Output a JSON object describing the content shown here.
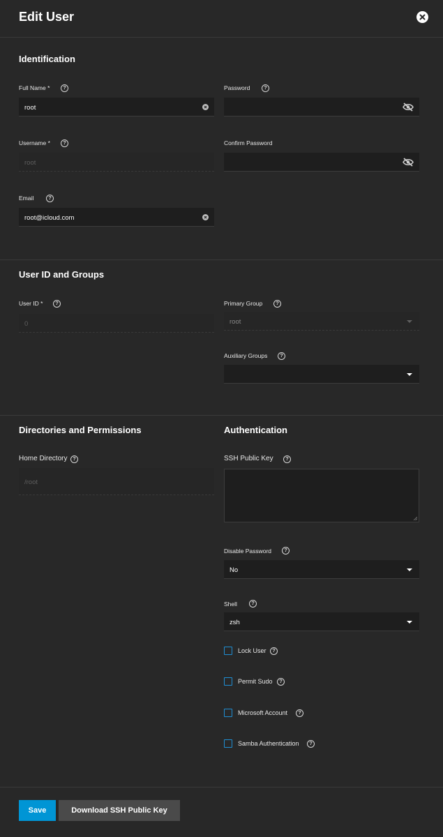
{
  "dialog": {
    "title": "Edit User"
  },
  "identification": {
    "title": "Identification",
    "full_name": {
      "label": "Full Name *",
      "value": "root"
    },
    "password": {
      "label": "Password",
      "value": ""
    },
    "username": {
      "label": "Username *",
      "value": "root"
    },
    "confirm_password": {
      "label": "Confirm Password",
      "value": ""
    },
    "email": {
      "label": "Email",
      "value": "root@icloud.com"
    }
  },
  "user_id_groups": {
    "title": "User ID and Groups",
    "user_id": {
      "label": "User ID *",
      "value": "0"
    },
    "primary_group": {
      "label": "Primary Group",
      "value": "root"
    },
    "auxiliary_groups": {
      "label": "Auxiliary Groups",
      "value": ""
    }
  },
  "directories": {
    "title": "Directories and Permissions",
    "home_directory": {
      "label": "Home Directory",
      "value": "/root"
    }
  },
  "authentication": {
    "title": "Authentication",
    "ssh_public_key": {
      "label": "SSH Public Key",
      "value": ""
    },
    "disable_password": {
      "label": "Disable Password",
      "value": "No"
    },
    "shell": {
      "label": "Shell",
      "value": "zsh"
    },
    "checkboxes": [
      {
        "label": "Lock User",
        "checked": false
      },
      {
        "label": "Permit Sudo",
        "checked": false
      },
      {
        "label": "Microsoft Account",
        "checked": false
      },
      {
        "label": "Samba Authentication",
        "checked": false
      }
    ]
  },
  "actions": {
    "save_label": "Save",
    "download_label": "Download SSH Public Key"
  },
  "help_glyph": "?",
  "colors": {
    "background": "#282828",
    "input_background": "#1e1e1e",
    "primary_button": "#0095d5",
    "secondary_button": "#4a4a4a",
    "checkbox_border": "#1f8fd4"
  },
  "icons": [
    "close-icon",
    "help-icon",
    "clear-icon",
    "eye-off-icon",
    "chevron-down-icon"
  ]
}
